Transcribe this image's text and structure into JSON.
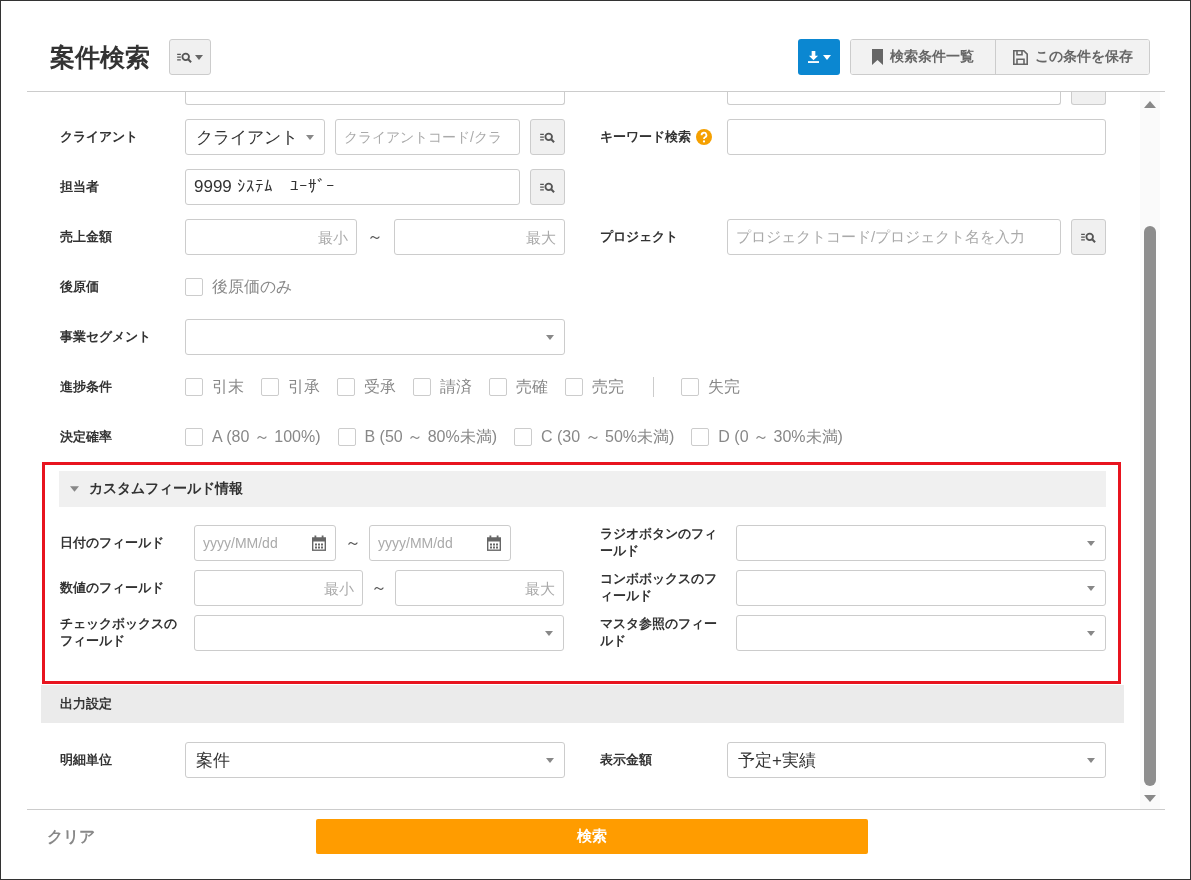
{
  "header": {
    "title": "案件検索",
    "buttons": [
      {
        "kind": "list",
        "label": "検索条件一覧"
      },
      {
        "kind": "save",
        "label": "この条件を保存"
      }
    ]
  },
  "form": {
    "rows": [
      {
        "left": {
          "kind": "cut"
        },
        "right": {
          "kind": "cut_search"
        }
      },
      {
        "left": {
          "kind": "select_search",
          "label": "クライアント",
          "value": "クライアント",
          "placeholder": "クライアントコード/クラ"
        },
        "right": {
          "kind": "text",
          "label": "キーワード検索",
          "help": true
        }
      },
      {
        "left": {
          "kind": "search",
          "label": "担当者",
          "value": "9999 ｼｽﾃﾑ　ﾕｰｻﾞｰ"
        }
      },
      {
        "left": {
          "kind": "range",
          "label": "売上金額",
          "min_placeholder": "最小",
          "separator": "～",
          "max_placeholder": "最大"
        },
        "right": {
          "kind": "search",
          "label": "プロジェクト",
          "placeholder": "プロジェクトコード/プロジェクト名を入力"
        }
      },
      {
        "left": {
          "kind": "checkbox",
          "label": "後原価",
          "option": {
            "label": "後原価のみ",
            "checked": false
          }
        }
      },
      {
        "left": {
          "kind": "select",
          "label": "事業セグメント"
        }
      },
      {
        "left": {
          "kind": "checkgroup",
          "label": "進捗条件",
          "options": [
            {
              "kind": "checkbox",
              "label": "引末",
              "checked": false
            },
            {
              "kind": "checkbox",
              "label": "引承",
              "checked": false
            },
            {
              "kind": "checkbox",
              "label": "受承",
              "checked": false
            },
            {
              "kind": "checkbox",
              "label": "請済",
              "checked": false
            },
            {
              "kind": "checkbox",
              "label": "売確",
              "checked": false
            },
            {
              "kind": "checkbox",
              "label": "売完",
              "checked": false
            },
            {
              "kind": "divider"
            },
            {
              "kind": "checkbox",
              "label": "失完",
              "checked": false
            }
          ]
        }
      },
      {
        "left": {
          "kind": "checkgroup",
          "label": "決定確率",
          "options": [
            {
              "kind": "checkbox",
              "label": "A (80 ～ 100%)",
              "checked": false
            },
            {
              "kind": "checkbox",
              "label": "B (50 ～ 80%未満)",
              "checked": false
            },
            {
              "kind": "checkbox",
              "label": "C (30 ～ 50%未満)",
              "checked": false
            },
            {
              "kind": "checkbox",
              "label": "D (0 ～ 30%未満)",
              "checked": false
            }
          ]
        }
      }
    ]
  },
  "custom_section": {
    "title": "カスタムフィールド情報",
    "expanded": true,
    "highlighted": true,
    "rows": [
      {
        "left": {
          "kind": "date_range",
          "label": "日付のフィールド",
          "from_placeholder": "yyyy/MM/dd",
          "separator": "～",
          "to_placeholder": "yyyy/MM/dd"
        },
        "right": {
          "kind": "select",
          "label": "ラジオボタンのフィールド"
        }
      },
      {
        "left": {
          "kind": "range",
          "label": "数値のフィールド",
          "min_placeholder": "最小",
          "separator": "～",
          "max_placeholder": "最大"
        },
        "right": {
          "kind": "select",
          "label": "コンボボックスのフィールド"
        }
      },
      {
        "left": {
          "kind": "select",
          "label": "チェックボックスのフィールド"
        },
        "right": {
          "kind": "select",
          "label": "マスタ参照のフィールド"
        }
      }
    ]
  },
  "output_section": {
    "title": "出力設定",
    "rows": [
      {
        "left": {
          "kind": "select",
          "label": "明細単位",
          "value": "案件"
        },
        "right": {
          "kind": "select",
          "label": "表示金額",
          "value": "予定+実績"
        }
      }
    ]
  },
  "footer": {
    "clear_link": "クリア",
    "search_button": "検索"
  }
}
